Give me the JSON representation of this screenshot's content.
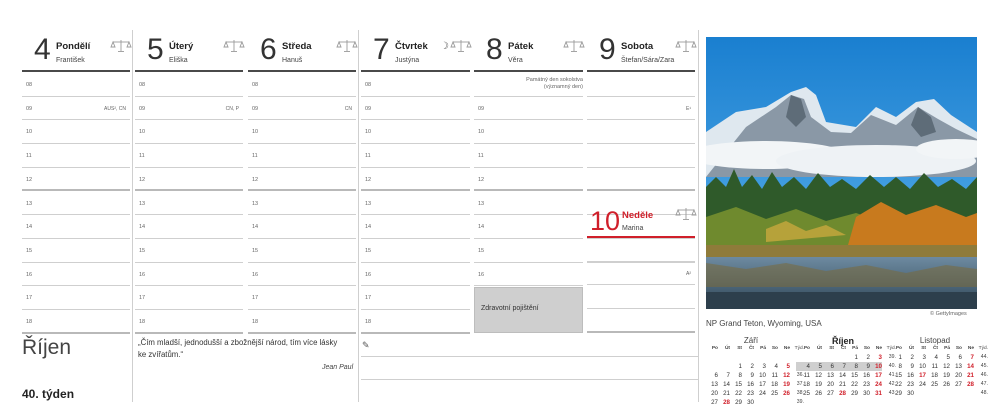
{
  "week": {
    "label": "40. týden",
    "month": "Říjen"
  },
  "days": [
    {
      "num": "4",
      "name": "Pondělí",
      "nameday": "František",
      "moon": ""
    },
    {
      "num": "5",
      "name": "Úterý",
      "nameday": "Eliška",
      "moon": ""
    },
    {
      "num": "6",
      "name": "Středa",
      "nameday": "Hanuš",
      "moon": ""
    },
    {
      "num": "7",
      "name": "Čtvrtek",
      "nameday": "Justýna",
      "moon": "☽"
    },
    {
      "num": "8",
      "name": "Pátek",
      "nameday": "Věra",
      "moon": ""
    },
    {
      "num": "9",
      "name": "Sobota",
      "nameday": "Štefan/Sára/Zara",
      "moon": ""
    }
  ],
  "sunday": {
    "num": "10",
    "name": "Neděle",
    "nameday": "Marina"
  },
  "hours": [
    "08",
    "09",
    "10",
    "11",
    "12",
    "13",
    "14",
    "15",
    "16",
    "17",
    "18"
  ],
  "slot_notes": {
    "mon_09": "AUS², CN",
    "tue_09": "CN, P",
    "wed_09": "CN",
    "sat_09": "E¹",
    "sat_16": "A²"
  },
  "friday_note": "Památný den sokolstva (významný den)",
  "friday_box": "Zdravotní pojištění",
  "quote": {
    "text": "„Čím mladší, jednodušší a zbožnější národ, tím více lásky ke zvířatům.“",
    "author": "Jean Paul"
  },
  "photo": {
    "credit": "© GettyImages",
    "caption": "NP Grand Teton, Wyoming, USA"
  },
  "minicals": [
    {
      "title": "Září",
      "headers": [
        "Po",
        "Út",
        "St",
        "Čt",
        "Pá",
        "So",
        "Ne",
        "Týd."
      ],
      "rows": [
        [
          "",
          "",
          "",
          "",
          "",
          "",
          "",
          ""
        ],
        [
          "",
          "",
          "1",
          "2",
          "3",
          "4",
          "5",
          "35."
        ],
        [
          "6",
          "7",
          "8",
          "9",
          "10",
          "11",
          "12",
          "36."
        ],
        [
          "13",
          "14",
          "15",
          "16",
          "17",
          "18",
          "19",
          "37."
        ],
        [
          "20",
          "21",
          "22",
          "23",
          "24",
          "25",
          "26",
          "38."
        ],
        [
          "27",
          "28",
          "29",
          "30",
          "",
          "",
          "",
          "39."
        ]
      ],
      "red": [
        "5",
        "12",
        "19",
        "26",
        "28"
      ]
    },
    {
      "title": "Říjen",
      "headers": [
        "Po",
        "Út",
        "St",
        "Čt",
        "Pá",
        "So",
        "Ne",
        "Týd."
      ],
      "rows": [
        [
          "",
          "",
          "",
          "",
          "1",
          "2",
          "3",
          "39."
        ],
        [
          "4",
          "5",
          "6",
          "7",
          "8",
          "9",
          "10",
          "40."
        ],
        [
          "11",
          "12",
          "13",
          "14",
          "15",
          "16",
          "17",
          "41."
        ],
        [
          "18",
          "19",
          "20",
          "21",
          "22",
          "23",
          "24",
          "42."
        ],
        [
          "25",
          "26",
          "27",
          "28",
          "29",
          "30",
          "31",
          "43."
        ]
      ],
      "red": [
        "3",
        "10",
        "17",
        "24",
        "28",
        "31"
      ]
    },
    {
      "title": "Listopad",
      "headers": [
        "Po",
        "Út",
        "St",
        "Čt",
        "Pá",
        "So",
        "Ne",
        "Týd."
      ],
      "rows": [
        [
          "1",
          "2",
          "3",
          "4",
          "5",
          "6",
          "7",
          "44."
        ],
        [
          "8",
          "9",
          "10",
          "11",
          "12",
          "13",
          "14",
          "45."
        ],
        [
          "15",
          "16",
          "17",
          "18",
          "19",
          "20",
          "21",
          "46."
        ],
        [
          "22",
          "23",
          "24",
          "25",
          "26",
          "27",
          "28",
          "47."
        ],
        [
          "29",
          "30",
          "",
          "",
          "",
          "",
          "",
          "48."
        ]
      ],
      "red": [
        "7",
        "14",
        "17",
        "21",
        "28"
      ]
    }
  ],
  "colors": {
    "accent": "#d01f2a",
    "grey_box": "#cfcfcf",
    "rule": "#4a4a4a"
  }
}
